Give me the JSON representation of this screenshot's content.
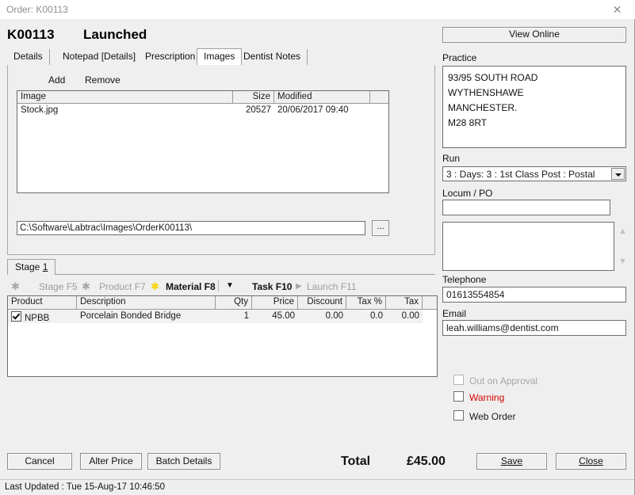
{
  "titlebar": {
    "title": "Order: K00113",
    "close_glyph": "✕"
  },
  "header": {
    "order_no": "K00113",
    "status": "Launched"
  },
  "tabs": [
    {
      "label": "Details",
      "active": false
    },
    {
      "label": "Notepad [Details]",
      "active": false
    },
    {
      "label": "Prescription",
      "active": false
    },
    {
      "label": "Images",
      "active": true
    },
    {
      "label": "Dentist Notes",
      "active": false
    }
  ],
  "images_panel": {
    "add_label": "Add",
    "remove_label": "Remove",
    "columns": [
      "Image",
      "Size",
      "Modified",
      ""
    ],
    "rows": [
      {
        "image": "Stock.jpg",
        "size": "20527",
        "modified": "20/06/2017 09:40",
        "extra": ""
      }
    ],
    "path": "C:\\Software\\Labtrac\\Images\\OrderK00113\\",
    "browse_label": "..."
  },
  "stage": {
    "tab_label_prefix": "Stage ",
    "tab_label_num": "1",
    "toolbar": [
      {
        "label": "Stage F5",
        "enabled": false,
        "asterisk": "gray"
      },
      {
        "label": "Product F7",
        "enabled": false,
        "asterisk": "gray"
      },
      {
        "label": "Material F8",
        "enabled": true,
        "asterisk": "yellow"
      },
      {
        "label": "Task F10",
        "enabled": true,
        "asterisk": "none"
      },
      {
        "label": "Launch F11",
        "enabled": false,
        "asterisk": "none"
      }
    ]
  },
  "product_grid": {
    "columns": [
      "Product",
      "Description",
      "Qty",
      "Price",
      "Discount",
      "Tax %",
      "Tax",
      ""
    ],
    "rows": [
      {
        "checked": true,
        "product": "NPBB",
        "description": "Porcelain Bonded Bridge",
        "qty": "1",
        "price": "45.00",
        "discount": "0.00",
        "tax_pct": "0.0",
        "tax": "0.00",
        "extra": ""
      }
    ]
  },
  "right_panel": {
    "view_online_label": "View Online",
    "practice_label": "Practice",
    "practice_address": [
      "93/95 SOUTH ROAD",
      "WYTHENSHAWE",
      "MANCHESTER.",
      "M28 8RT"
    ],
    "run_label": "Run",
    "run_value": "3 : Days: 3 : 1st Class Post : Postal",
    "locum_label": "Locum / PO",
    "locum_value": "",
    "notes_value": "",
    "telephone_label": "Telephone",
    "telephone_value": "01613554854",
    "email_label": "Email",
    "email_value": "leah.williams@dentist.com",
    "checkboxes": [
      {
        "label": "Out on Approval",
        "checked": false,
        "state": "disabled"
      },
      {
        "label": "Warning",
        "checked": false,
        "state": "warning"
      },
      {
        "label": "Web Order",
        "checked": false,
        "state": "normal"
      }
    ]
  },
  "footer": {
    "cancel_label": "Cancel",
    "alter_price_label": "Alter Price",
    "batch_details_label": "Batch Details",
    "total_label": "Total",
    "total_value": "£45.00",
    "save_label": "Save",
    "close_label": "Close"
  },
  "statusbar": {
    "text": "Last Updated : Tue 15-Aug-17 10:46:50"
  }
}
